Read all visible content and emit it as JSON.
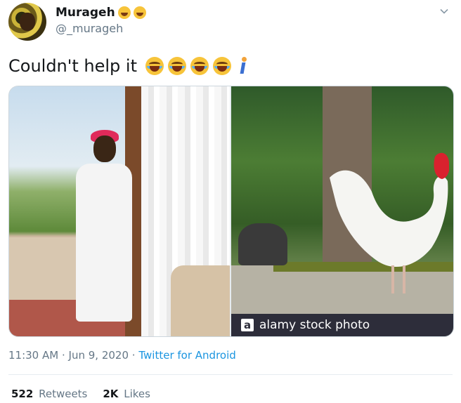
{
  "author": {
    "name": "Murageh",
    "handle": "@_murageh",
    "name_emojis": [
      "face-savoring-food-icon",
      "grinning-face-icon"
    ]
  },
  "tweet": {
    "text": "Couldn't help it",
    "trailing_emojis": [
      "face-with-tears-of-joy-icon",
      "face-with-tears-of-joy-icon",
      "face-with-tears-of-joy-icon",
      "face-with-tears-of-joy-icon",
      "person-walking-icon"
    ]
  },
  "media": {
    "watermark_logo": "a",
    "watermark_text": "alamy stock photo"
  },
  "meta": {
    "time": "11:30 AM",
    "date": "Jun 9, 2020",
    "source": "Twitter for Android",
    "separator": "·"
  },
  "stats": {
    "retweets_count": "522",
    "retweets_label": "Retweets",
    "likes_count": "2K",
    "likes_label": "Likes"
  },
  "colors": {
    "link": "#1b95e0",
    "secondary_text": "#657786",
    "primary_text": "#14171a"
  }
}
